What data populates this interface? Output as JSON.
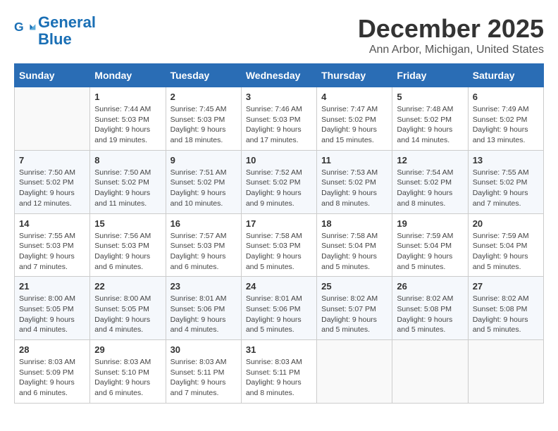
{
  "header": {
    "logo_line1": "General",
    "logo_line2": "Blue",
    "title": "December 2025",
    "subtitle": "Ann Arbor, Michigan, United States"
  },
  "days_of_week": [
    "Sunday",
    "Monday",
    "Tuesday",
    "Wednesday",
    "Thursday",
    "Friday",
    "Saturday"
  ],
  "weeks": [
    [
      {
        "day": "",
        "info": ""
      },
      {
        "day": "1",
        "info": "Sunrise: 7:44 AM\nSunset: 5:03 PM\nDaylight: 9 hours\nand 19 minutes."
      },
      {
        "day": "2",
        "info": "Sunrise: 7:45 AM\nSunset: 5:03 PM\nDaylight: 9 hours\nand 18 minutes."
      },
      {
        "day": "3",
        "info": "Sunrise: 7:46 AM\nSunset: 5:03 PM\nDaylight: 9 hours\nand 17 minutes."
      },
      {
        "day": "4",
        "info": "Sunrise: 7:47 AM\nSunset: 5:02 PM\nDaylight: 9 hours\nand 15 minutes."
      },
      {
        "day": "5",
        "info": "Sunrise: 7:48 AM\nSunset: 5:02 PM\nDaylight: 9 hours\nand 14 minutes."
      },
      {
        "day": "6",
        "info": "Sunrise: 7:49 AM\nSunset: 5:02 PM\nDaylight: 9 hours\nand 13 minutes."
      }
    ],
    [
      {
        "day": "7",
        "info": "Sunrise: 7:50 AM\nSunset: 5:02 PM\nDaylight: 9 hours\nand 12 minutes."
      },
      {
        "day": "8",
        "info": "Sunrise: 7:50 AM\nSunset: 5:02 PM\nDaylight: 9 hours\nand 11 minutes."
      },
      {
        "day": "9",
        "info": "Sunrise: 7:51 AM\nSunset: 5:02 PM\nDaylight: 9 hours\nand 10 minutes."
      },
      {
        "day": "10",
        "info": "Sunrise: 7:52 AM\nSunset: 5:02 PM\nDaylight: 9 hours\nand 9 minutes."
      },
      {
        "day": "11",
        "info": "Sunrise: 7:53 AM\nSunset: 5:02 PM\nDaylight: 9 hours\nand 8 minutes."
      },
      {
        "day": "12",
        "info": "Sunrise: 7:54 AM\nSunset: 5:02 PM\nDaylight: 9 hours\nand 8 minutes."
      },
      {
        "day": "13",
        "info": "Sunrise: 7:55 AM\nSunset: 5:02 PM\nDaylight: 9 hours\nand 7 minutes."
      }
    ],
    [
      {
        "day": "14",
        "info": "Sunrise: 7:55 AM\nSunset: 5:03 PM\nDaylight: 9 hours\nand 7 minutes."
      },
      {
        "day": "15",
        "info": "Sunrise: 7:56 AM\nSunset: 5:03 PM\nDaylight: 9 hours\nand 6 minutes."
      },
      {
        "day": "16",
        "info": "Sunrise: 7:57 AM\nSunset: 5:03 PM\nDaylight: 9 hours\nand 6 minutes."
      },
      {
        "day": "17",
        "info": "Sunrise: 7:58 AM\nSunset: 5:03 PM\nDaylight: 9 hours\nand 5 minutes."
      },
      {
        "day": "18",
        "info": "Sunrise: 7:58 AM\nSunset: 5:04 PM\nDaylight: 9 hours\nand 5 minutes."
      },
      {
        "day": "19",
        "info": "Sunrise: 7:59 AM\nSunset: 5:04 PM\nDaylight: 9 hours\nand 5 minutes."
      },
      {
        "day": "20",
        "info": "Sunrise: 7:59 AM\nSunset: 5:04 PM\nDaylight: 9 hours\nand 5 minutes."
      }
    ],
    [
      {
        "day": "21",
        "info": "Sunrise: 8:00 AM\nSunset: 5:05 PM\nDaylight: 9 hours\nand 4 minutes."
      },
      {
        "day": "22",
        "info": "Sunrise: 8:00 AM\nSunset: 5:05 PM\nDaylight: 9 hours\nand 4 minutes."
      },
      {
        "day": "23",
        "info": "Sunrise: 8:01 AM\nSunset: 5:06 PM\nDaylight: 9 hours\nand 4 minutes."
      },
      {
        "day": "24",
        "info": "Sunrise: 8:01 AM\nSunset: 5:06 PM\nDaylight: 9 hours\nand 5 minutes."
      },
      {
        "day": "25",
        "info": "Sunrise: 8:02 AM\nSunset: 5:07 PM\nDaylight: 9 hours\nand 5 minutes."
      },
      {
        "day": "26",
        "info": "Sunrise: 8:02 AM\nSunset: 5:08 PM\nDaylight: 9 hours\nand 5 minutes."
      },
      {
        "day": "27",
        "info": "Sunrise: 8:02 AM\nSunset: 5:08 PM\nDaylight: 9 hours\nand 5 minutes."
      }
    ],
    [
      {
        "day": "28",
        "info": "Sunrise: 8:03 AM\nSunset: 5:09 PM\nDaylight: 9 hours\nand 6 minutes."
      },
      {
        "day": "29",
        "info": "Sunrise: 8:03 AM\nSunset: 5:10 PM\nDaylight: 9 hours\nand 6 minutes."
      },
      {
        "day": "30",
        "info": "Sunrise: 8:03 AM\nSunset: 5:11 PM\nDaylight: 9 hours\nand 7 minutes."
      },
      {
        "day": "31",
        "info": "Sunrise: 8:03 AM\nSunset: 5:11 PM\nDaylight: 9 hours\nand 8 minutes."
      },
      {
        "day": "",
        "info": ""
      },
      {
        "day": "",
        "info": ""
      },
      {
        "day": "",
        "info": ""
      }
    ]
  ]
}
